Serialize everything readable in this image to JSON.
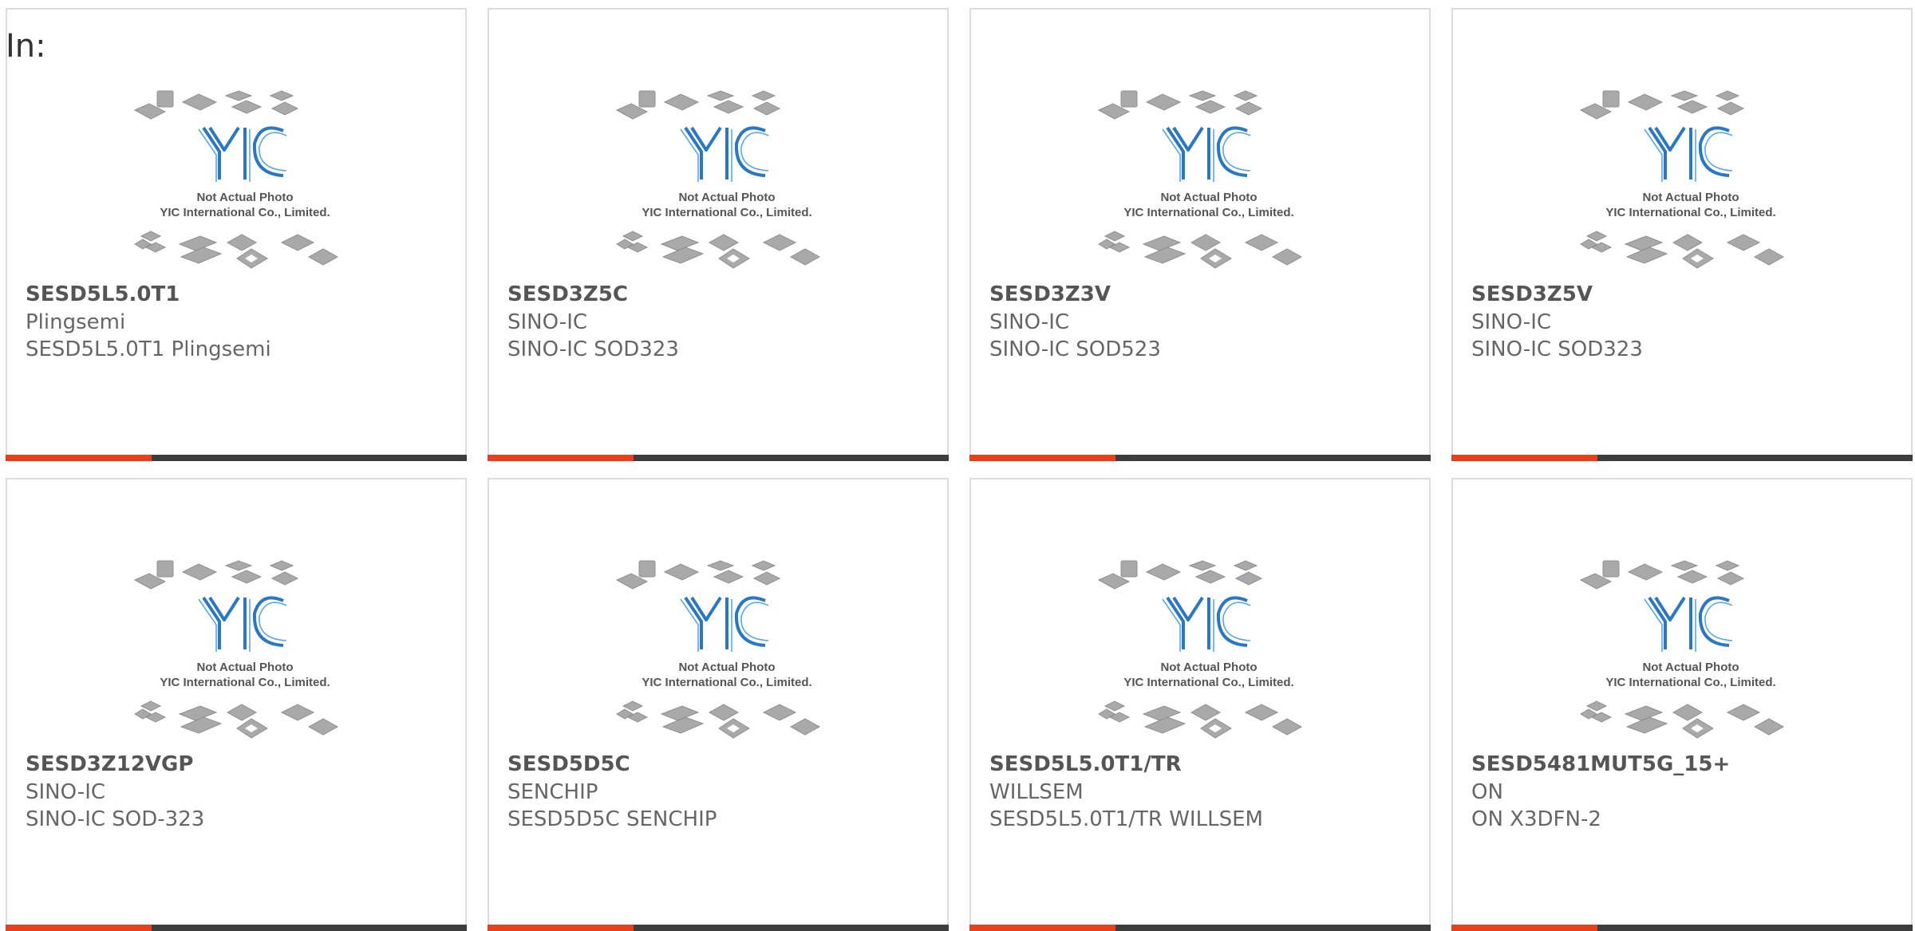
{
  "page": {
    "label": "In:"
  },
  "colors": {
    "accent": "#e8401c",
    "bar": "#3d3d3d",
    "logo": "#2a78c2"
  },
  "photo": {
    "logo_text": "YIC",
    "caption_line1": "Not Actual Photo",
    "caption_line2": "YIC International Co., Limited."
  },
  "products": [
    {
      "name": "SESD5L5.0T1",
      "brand": "Plingsemi",
      "desc": "SESD5L5.0T1 Plingsemi"
    },
    {
      "name": "SESD3Z5C",
      "brand": "SINO-IC",
      "desc": "SINO-IC SOD323"
    },
    {
      "name": "SESD3Z3V",
      "brand": "SINO-IC",
      "desc": "SINO-IC SOD523"
    },
    {
      "name": "SESD3Z5V",
      "brand": "SINO-IC",
      "desc": "SINO-IC SOD323"
    },
    {
      "name": "SESD3Z12VGP",
      "brand": "SINO-IC",
      "desc": "SINO-IC SOD-323"
    },
    {
      "name": "SESD5D5C",
      "brand": "SENCHIP",
      "desc": "SESD5D5C SENCHIP"
    },
    {
      "name": "SESD5L5.0T1/TR",
      "brand": "WILLSEM",
      "desc": "SESD5L5.0T1/TR WILLSEM"
    },
    {
      "name": "SESD5481MUT5G_15+",
      "brand": "ON",
      "desc": "ON X3DFN-2"
    }
  ]
}
